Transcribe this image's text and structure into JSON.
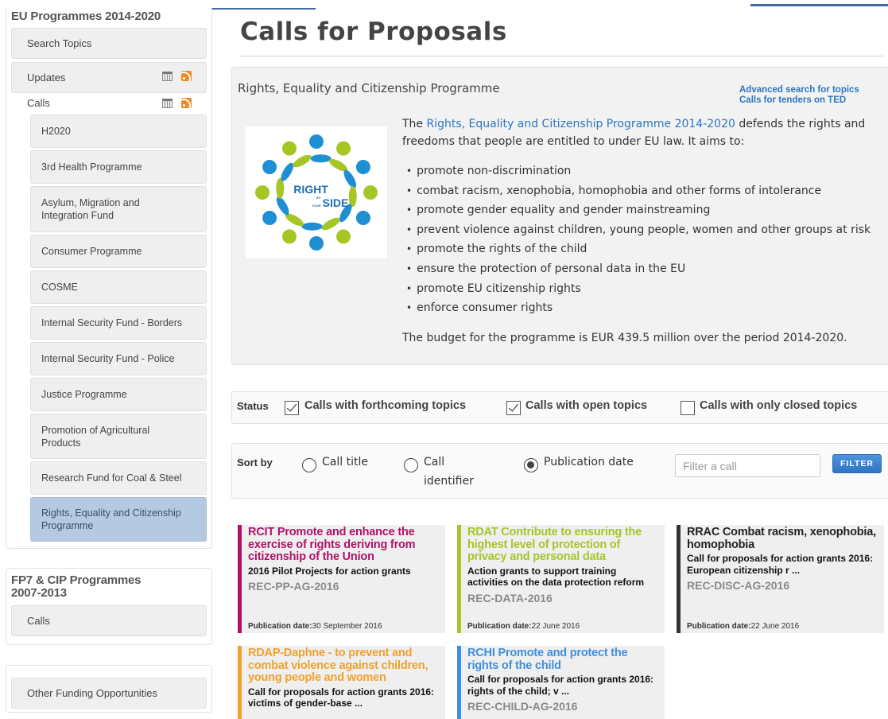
{
  "sidebar": {
    "section1_title": "EU Programmes 2014-2020",
    "search_topics": "Search Topics",
    "updates": "Updates",
    "calls": "Calls",
    "calls_items": [
      "H2020",
      "3rd Health Programme",
      "Asylum, Migration and Integration Fund",
      "Consumer Programme",
      "COSME",
      "Internal Security Fund - Borders",
      "Internal Security Fund - Police",
      "Justice Programme",
      "Promotion of Agricultural Products",
      "Research Fund for Coal & Steel",
      "Rights, Equality and Citizenship Programme"
    ],
    "active_item": "Rights, Equality and Citizenship Programme",
    "section2_title": "FP7 & CIP Programmes 2007-2013",
    "section2_calls": "Calls",
    "other_funding": "Other Funding Opportunities"
  },
  "main": {
    "title": "Calls for Proposals",
    "programme_name": "Rights, Equality and Citizenship Programme",
    "advanced_search": "Advanced search for topics",
    "tenders_link": "Calls for tenders on TED",
    "logo": {
      "word1": "RIGHT",
      "word_by": "BY",
      "word_your": "YOUR",
      "word2": "SIDE",
      "colors": [
        "#1f8fd3",
        "#a6c626"
      ]
    },
    "desc_prefix": "The ",
    "desc_link": "Rights, Equality and Citizenship Programme 2014-2020",
    "desc_suffix": " defends the rights and freedoms that people are entitled to under EU law. It aims to:",
    "bullets": [
      "promote non-discrimination",
      "combat racism, xenophobia, homophobia and other forms of intolerance",
      "promote gender equality and gender mainstreaming",
      "prevent violence against children, young people, women and other groups at risk",
      "promote the rights of the child",
      "ensure the protection of personal data in the EU",
      "promote EU citizenship rights",
      "enforce consumer rights"
    ],
    "budget": "The budget for the programme is EUR 439.5 million over the period 2014-2020."
  },
  "filters": {
    "status_label": "Status",
    "status_options": [
      {
        "label": "Calls with forthcoming topics",
        "checked": true
      },
      {
        "label": "Calls with open topics",
        "checked": true
      },
      {
        "label": "Calls with only closed topics",
        "checked": false
      }
    ],
    "sort_label": "Sort by",
    "sort_options": [
      {
        "label": "Call title",
        "selected": false
      },
      {
        "label_line1": "Call",
        "label_line2": "identifier",
        "selected": false
      },
      {
        "label": "Publication date",
        "selected": true
      }
    ],
    "filter_placeholder": "Filter a call",
    "filter_button": "FILTER"
  },
  "cards": [
    {
      "title": "RCIT Promote and enhance the exercise of rights deriving from citizenship of the Union",
      "subtitle": "2016 Pilot Projects for action grants",
      "identifier": "REC-PP-AG-2016",
      "date_label": "Publication date:",
      "date": "30 September 2016",
      "color": "#b0126a"
    },
    {
      "title": "RDAT Contribute to ensuring the highest level of protection of privacy and personal data",
      "subtitle": "Action grants to support training activities on the data protection reform",
      "identifier": "REC-DATA-2016",
      "date_label": "Publication date:",
      "date": "22 June 2016",
      "color": "#a6c626"
    },
    {
      "title": "RRAC Combat racism, xenophobia, homophobia",
      "subtitle": "Call for proposals for action grants 2016: European citizenship r ...",
      "identifier": "REC-DISC-AG-2016",
      "date_label": "Publication date:",
      "date": "22 June 2016",
      "color": "#333333"
    },
    {
      "title": "RDAP-Daphne - to prevent and combat violence against children, young people and women",
      "subtitle": "Call for proposals for action grants 2016: victims of gender-base ...",
      "identifier": "",
      "date_label": "",
      "date": "",
      "color": "#f2a12c"
    },
    {
      "title": "RCHI Promote and protect the rights of the child",
      "subtitle": "Call for proposals for action grants 2016: rights of the child; v ...",
      "identifier": "REC-CHILD-AG-2016",
      "date_label": "",
      "date": "",
      "color": "#3f8fe0"
    }
  ]
}
